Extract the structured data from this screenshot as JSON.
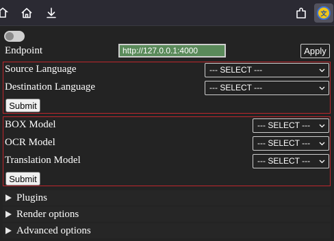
{
  "toolbar": {
    "icons": [
      "puzzle-overflow-icon",
      "home-icon",
      "download-icon",
      "extensions-icon",
      "translator-extension-icon"
    ]
  },
  "settings": {
    "endpoint_label": "Endpoint",
    "endpoint_value": "http://127.0.0.1:4000",
    "apply_label": "Apply"
  },
  "languages": {
    "source_label": "Source Language",
    "source_value": "--- SELECT ---",
    "destination_label": "Destination Language",
    "destination_value": "--- SELECT ---",
    "submit_label": "Submit"
  },
  "models": {
    "box_label": "BOX Model",
    "box_value": "--- SELECT ---",
    "ocr_label": "OCR Model",
    "ocr_value": "--- SELECT ---",
    "translation_label": "Translation Model",
    "translation_value": "--- SELECT ---",
    "submit_label": "Submit"
  },
  "sections": {
    "plugins": "Plugins",
    "render_options": "Render options",
    "advanced_options": "Advanced options"
  },
  "colors": {
    "background": "#232323",
    "group_border": "#c0272d",
    "endpoint_field": "#5a8a5a"
  }
}
